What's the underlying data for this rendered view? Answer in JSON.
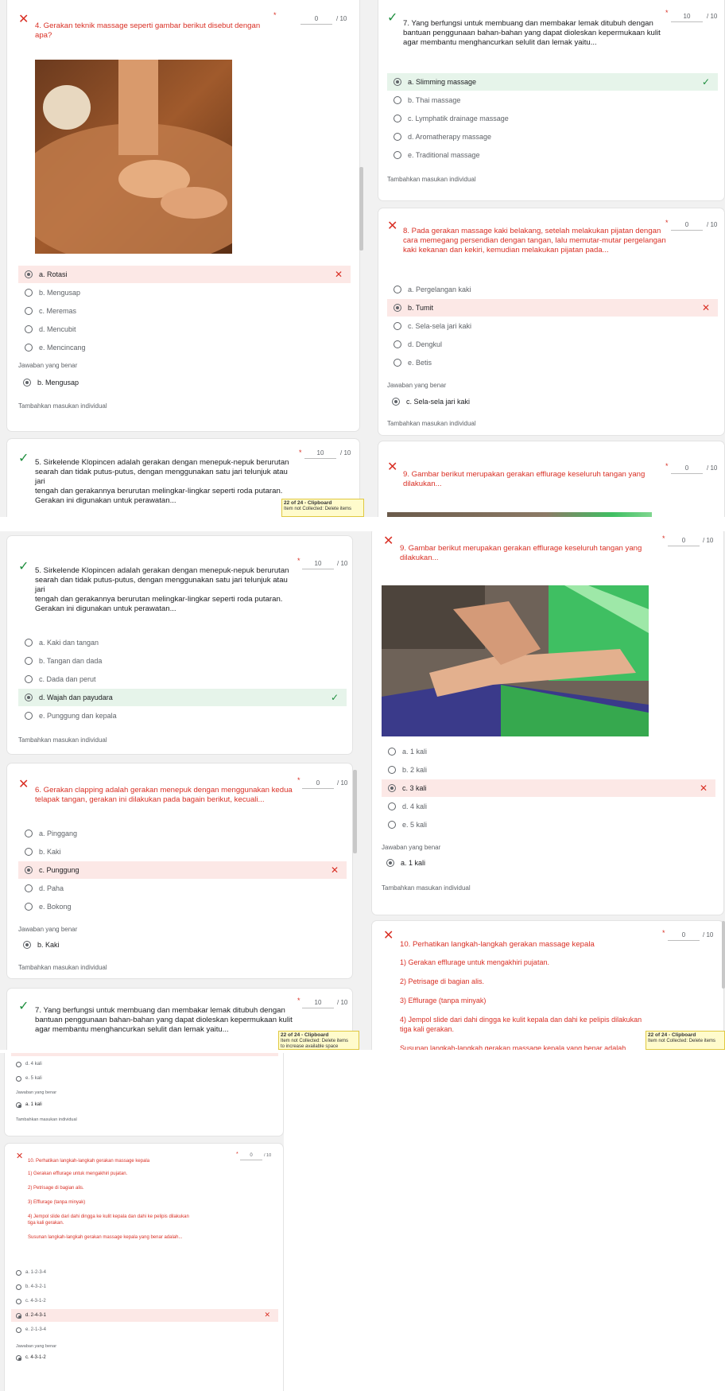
{
  "labels": {
    "correct_answer": "Jawaban yang benar",
    "feedback": "Tambahkan masukan individual",
    "score_sep": "/ 10"
  },
  "clipboard": {
    "title": "22 of 24 - Clipboard",
    "line_a": "Item not Collected: Delete items",
    "line_b": "Item not Collected: Delete items",
    "line_c": "to increase available space"
  },
  "q4": {
    "text": "4. Gerakan teknik massage seperti gambar berikut disebut dengan apa?",
    "score": "0",
    "options": [
      "a. Rotasi",
      "b. Mengusap",
      "c. Meremas",
      "d. Mencubit",
      "e. Mencincang"
    ],
    "correct": "b. Mengusap"
  },
  "q5": {
    "text_1": "5. Sirkelende Klopincen adalah gerakan dengan menepuk-nepuk berurutan",
    "text_2": "searah dan tidak putus-putus, dengan menggunakan satu jari telunjuk atau jari",
    "text_3": "tengah dan gerakannya berurutan melingkar-lingkar seperti roda putaran.",
    "text_4": "Gerakan ini digunakan untuk perawatan...",
    "score": "10",
    "options": [
      "a. Kaki dan tangan",
      "b. Tangan dan dada",
      "c. Dada dan perut",
      "d. Wajah dan payudara",
      "e. Punggung dan kepala"
    ]
  },
  "q6": {
    "text_1": "6. Gerakan clapping adalah gerakan menepuk dengan menggunakan kedua",
    "text_2": "telapak tangan, gerakan ini dilakukan pada bagain berikut, kecuali...",
    "score": "0",
    "options": [
      "a. Pinggang",
      "b. Kaki",
      "c. Punggung",
      "d. Paha",
      "e. Bokong"
    ],
    "correct": "b. Kaki"
  },
  "q7": {
    "text_1": "7. Yang berfungsi untuk membuang dan membakar lemak ditubuh dengan",
    "text_2": "bantuan penggunaan bahan-bahan yang dapat dioleskan kepermukaan kulit",
    "text_3": "agar membantu menghancurkan selulit dan lemak yaitu...",
    "score": "10",
    "options": [
      "a. Slimming massage",
      "b. Thai massage",
      "c. Lymphatik drainage massage",
      "d. Aromatherapy massage",
      "e. Traditional massage"
    ]
  },
  "q8": {
    "text_1": "8. Pada gerakan massage kaki belakang, setelah melakukan pijatan dengan",
    "text_2": "cara memegang persendian dengan tangan, lalu memutar-mutar pergelangan",
    "text_3": "kaki kekanan dan kekiri, kemudian melakukan pijatan pada...",
    "score": "0",
    "options": [
      "a. Pergelangan kaki",
      "b. Tumit",
      "c. Sela-sela jari kaki",
      "d. Dengkul",
      "e. Betis"
    ],
    "correct": "c. Sela-sela jari kaki"
  },
  "q9": {
    "text_1": "9. Gambar berikut merupakan gerakan efflurage keseluruh tangan yang",
    "text_2": "dilakukan...",
    "score": "0",
    "options": [
      "a. 1 kali",
      "b. 2 kali",
      "c. 3 kali",
      "d. 4 kali",
      "e. 5 kali"
    ],
    "correct": "a. 1 kali"
  },
  "q10": {
    "text": "10. Perhatikan langkah-langkah gerakan massage kepala",
    "score": "0",
    "step1": "1)    Gerakan efflurage untuk mengakhiri pujatan.",
    "step2": "2)    Petrisage di bagian alis.",
    "step3": "3)    Efflurage (tanpa minyak)",
    "step4a": "4)    Jempol slide dari dahi dingga ke kulit kepala dan dahi ke pelipis dilakukan",
    "step4b": "tiga kali gerakan.",
    "prompt": "Susunan langkah-langkah gerakan massage kepala yang benar adalah...",
    "options": [
      "a. 1-2-3-4",
      "b. 4-3-2-1",
      "c. 4-3-1-2",
      "d. 2-4-3-1",
      "e. 2-1-3-4"
    ],
    "correct": "c. 4-3-1-2"
  }
}
